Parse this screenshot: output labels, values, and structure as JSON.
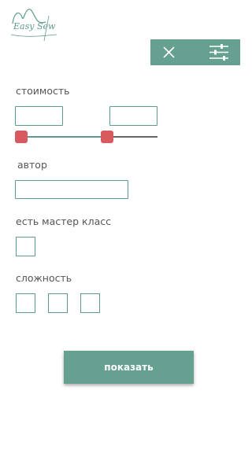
{
  "brand": {
    "logo_text": "Easy Sew"
  },
  "filters": {
    "price": {
      "label": "стоимость",
      "min_value": "",
      "max_value": "",
      "range_low": 0,
      "range_high": 0.66
    },
    "author": {
      "label": "автор",
      "value": ""
    },
    "masterclass": {
      "label": "есть мастер класс",
      "checked": false
    },
    "difficulty": {
      "label": "сложность",
      "levels": [
        false,
        false,
        false
      ]
    }
  },
  "actions": {
    "show_label": "показать"
  },
  "colors": {
    "accent": "#65a091",
    "thumb": "#d75a5f",
    "track": "#666666"
  },
  "icons": {
    "close": "close-icon",
    "filter": "filter-sliders-icon"
  }
}
